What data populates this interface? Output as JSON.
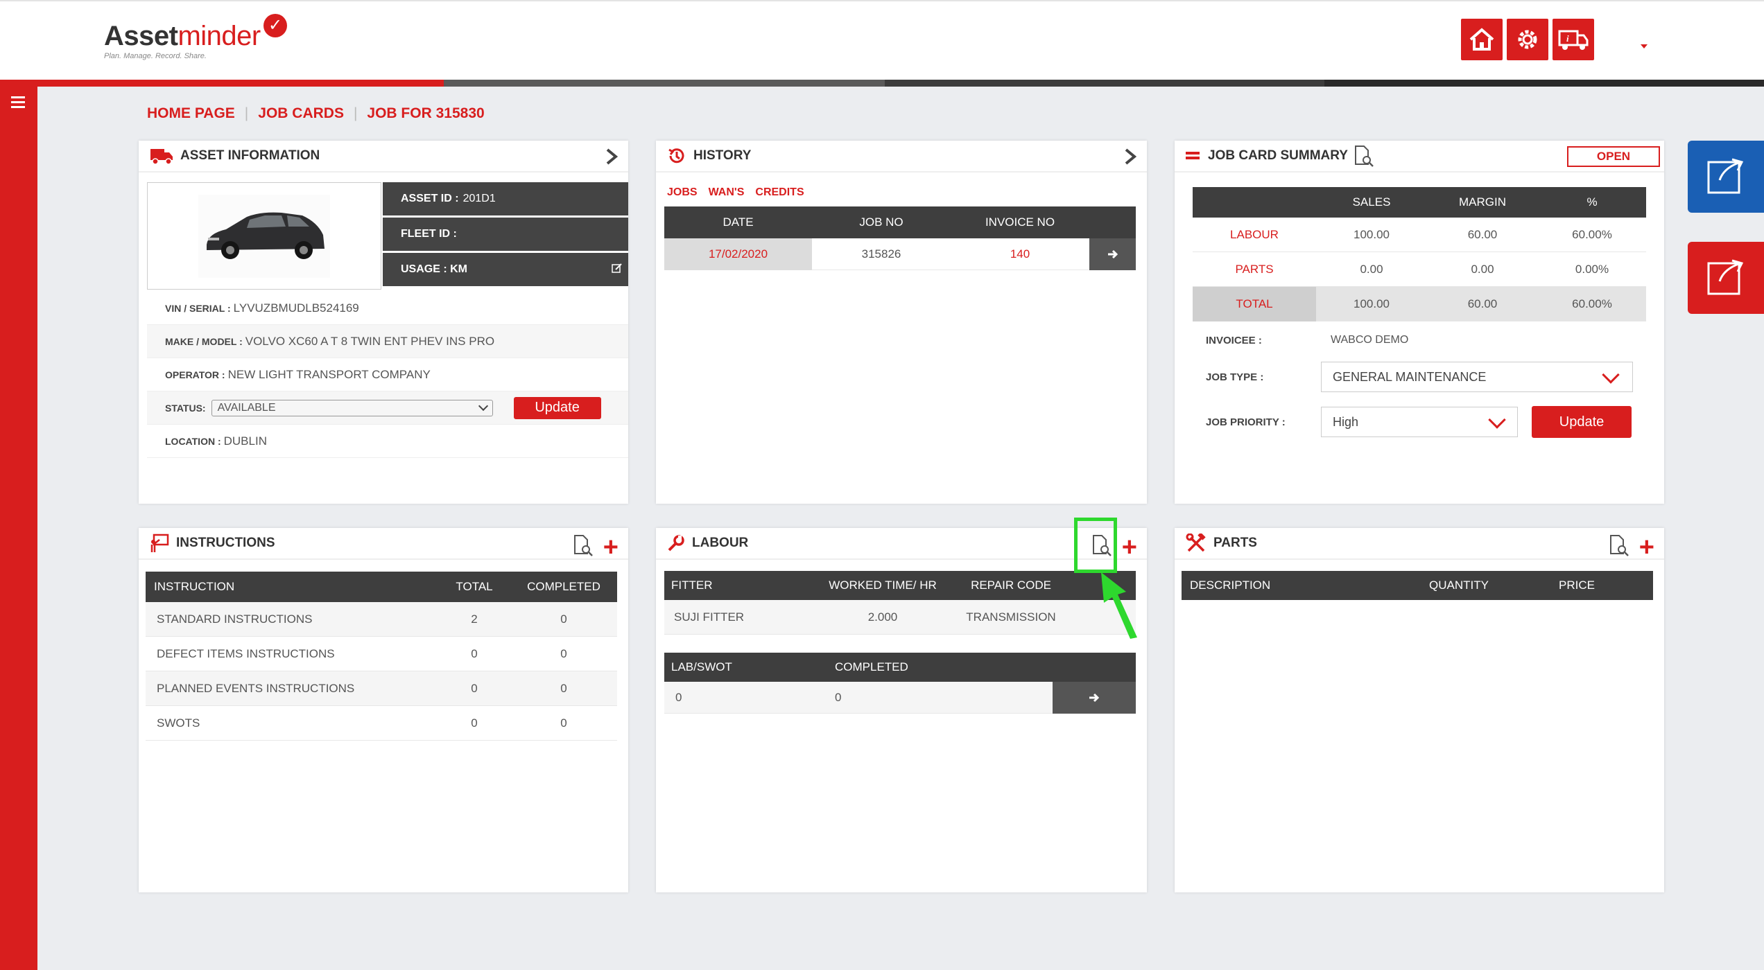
{
  "app": {
    "logo_main": "Asset",
    "logo_accent": "minder",
    "logo_tagline": "Plan. Manage. Record. Share."
  },
  "header": {
    "icons": [
      "home-icon",
      "settings-gear-icon",
      "truck-info-icon"
    ]
  },
  "breadcrumb": {
    "home": "HOME PAGE",
    "job_cards": "JOB CARDS",
    "current": "JOB FOR 315830"
  },
  "asset_info": {
    "title": "ASSET INFORMATION",
    "asset_id_label": "ASSET ID :",
    "asset_id": "201D1",
    "fleet_id_label": "FLEET ID :",
    "fleet_id": "",
    "usage_label": "USAGE : KM",
    "vin_label": "VIN / SERIAL :",
    "vin": "LYVUZBMUDLB524169",
    "make_label": "MAKE / MODEL :",
    "make": "VOLVO XC60 A T 8 TWIN ENT PHEV INS PRO",
    "operator_label": "OPERATOR :",
    "operator": "NEW LIGHT TRANSPORT COMPANY",
    "status_label": "STATUS:",
    "status": "AVAILABLE",
    "update": "Update",
    "location_label": "LOCATION :",
    "location": "DUBLIN"
  },
  "history": {
    "title": "HISTORY",
    "tabs": [
      "JOBS",
      "WAN'S",
      "CREDITS"
    ],
    "columns": [
      "DATE",
      "JOB NO",
      "INVOICE NO"
    ],
    "rows": [
      {
        "date": "17/02/2020",
        "job_no": "315826",
        "invoice_no": "140"
      }
    ]
  },
  "summary": {
    "title": "JOB CARD SUMMARY",
    "status": "OPEN",
    "columns": [
      "",
      "SALES",
      "MARGIN",
      "%"
    ],
    "rows": [
      {
        "label": "LABOUR",
        "sales": "100.00",
        "margin": "60.00",
        "pct": "60.00%"
      },
      {
        "label": "PARTS",
        "sales": "0.00",
        "margin": "0.00",
        "pct": "0.00%"
      },
      {
        "label": "TOTAL",
        "sales": "100.00",
        "margin": "60.00",
        "pct": "60.00%"
      }
    ],
    "invoicee_label": "INVOICEE :",
    "invoicee": "WABCO DEMO",
    "job_type_label": "JOB TYPE :",
    "job_type": "GENERAL MAINTENANCE",
    "priority_label": "JOB PRIORITY :",
    "priority": "High",
    "update": "Update"
  },
  "instructions": {
    "title": "INSTRUCTIONS",
    "columns": [
      "INSTRUCTION",
      "TOTAL",
      "COMPLETED"
    ],
    "rows": [
      {
        "name": "STANDARD INSTRUCTIONS",
        "total": "2",
        "completed": "0"
      },
      {
        "name": "DEFECT ITEMS INSTRUCTIONS",
        "total": "0",
        "completed": "0"
      },
      {
        "name": "PLANNED EVENTS INSTRUCTIONS",
        "total": "0",
        "completed": "0"
      },
      {
        "name": "SWOTS",
        "total": "0",
        "completed": "0"
      }
    ]
  },
  "labour": {
    "title": "LABOUR",
    "columns": [
      "FITTER",
      "WORKED TIME/ HR",
      "REPAIR CODE"
    ],
    "rows": [
      {
        "fitter": "SUJI FITTER",
        "time": "2.000",
        "code": "TRANSMISSION"
      }
    ],
    "swot_columns": [
      "LAB/SWOT",
      "COMPLETED"
    ],
    "swot_rows": [
      {
        "lab": "0",
        "completed": "0"
      }
    ]
  },
  "parts": {
    "title": "PARTS",
    "columns": [
      "DESCRIPTION",
      "QUANTITY",
      "PRICE"
    ]
  },
  "colors": {
    "brand_red": "#d81e1e",
    "dark_header": "#3e3e3e",
    "highlight_green": "#2ed82e",
    "tile_blue": "#1a5fb4"
  }
}
